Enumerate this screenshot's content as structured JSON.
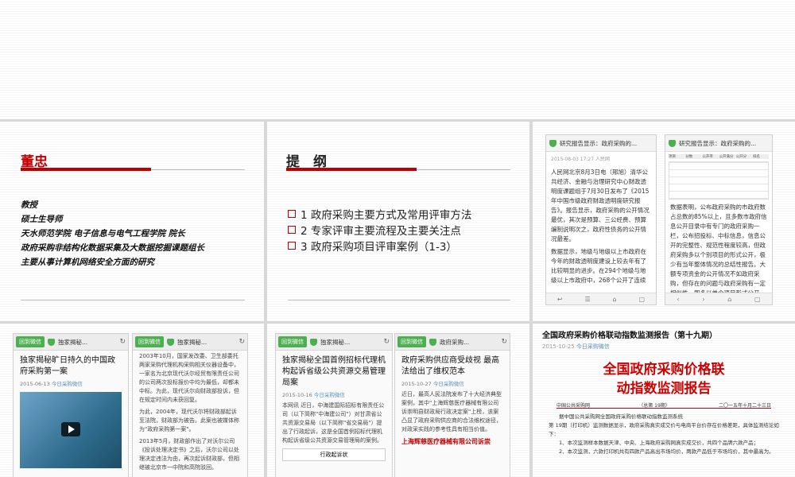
{
  "slide_intro": {
    "name": "董忠",
    "lines": [
      "教授",
      "硕士生导师",
      "天水师范学院 电子信息与电气工程学院 院长",
      "政府采购非结构化数据采集及大数据挖掘课题组长",
      "主要从事计算机网络安全方面的研究"
    ]
  },
  "slide_outline": {
    "title": "提　纲",
    "items": [
      "1 政府采购主要方式及常用评审方法",
      "2 专家评审主要流程及主要关注点",
      "3 政府采购项目评审案例（1-3）"
    ]
  },
  "phone1": {
    "header": "研究报告显示：政府采购的...",
    "date": "2015-08-03 17:27 人民网",
    "p1": "人民网北京8月3日电（邢旭）清华公共经济、金融与治理研究中心财政透明度课题组于7月30日发布了《2015年中国市级政府财政透明度研究报告》。报告显示，政府采购的公开情况最优，其次是预算、三公经费、预算编制说明次之，政府性债务的公开情况最差。",
    "p2": "数据显示，地级与地级以上市政府在今年的财政透明度建设上较去年有了比较明显的进步。在294个地级与地级以上市政府中，268个公开了连续"
  },
  "phone2": {
    "header": "研究报告显示：政府采购的...",
    "table_header": [
      "项目",
      "分数",
      "公开率",
      "公开满分",
      "公开分",
      "排名"
    ],
    "p1": "数据表明，公布政府采购的市政府数占总数的85%以上，且多数市政府信息公开目录中有专门的政府采购一栏，公布招投标、中标信息，信息公开的完整性、规范性程度较高，但政府采购多以个别项目的形式公开，极少有当年整体情况的总结性报告。大额专项资金的公开情况不如政府采购，但存在的问题与政府采购有一定相似性，即多以单个项目形式公开"
  },
  "wx1": {
    "back": "回到微信",
    "header": "独家揭秘...",
    "title": "独家揭秘旷日持久的中国政府采购第一案",
    "date": "2015-06-13",
    "source": "今日采购微信"
  },
  "wx2": {
    "back": "回到微信",
    "header": "独家揭秘...",
    "p1": "2003年10月，国家发改委、卫生部委托两家采购代理机构采购相关仪器设备中，一家名为北京现代沃尔经贸有限责任公司的公司两次投标报价中均为最低，却都未中标。为此，现代沃尔向财政部投诉，但在规定时间内未获回复。",
    "p2": "为此，2004年，现代沃尔将财政部起诉至法院，财政部为被告。此案也被媒体称为\"政府采购第一案\"。",
    "p3": "2013年5月，财政部作出了对沃尔公司《投诉处理决定书》之后，沃尔公司以处理决定违法为由，再次起诉财政部，但相继被北京市一中院和高院驳回。"
  },
  "wx3": {
    "back": "回到微信",
    "header": "独家揭秘...",
    "title": "独家揭秘全国首例招标代理机构起诉省级公共资源交易管理局案",
    "date": "2015-10-16",
    "source": "今日采购微信",
    "p1": "本网讯 近日，中海建国际招标有限责任公司（以下简称\"中海建公司\"）对甘肃省公共资源交易局（以下简称\"省交易局\"）提出了行政起诉，这是全国首例招标代理机构起诉省级公共资源交易管理局的案例。",
    "doc_title": "行政起诉状"
  },
  "wx4": {
    "back": "回到微信",
    "header": "政府采购...",
    "title": "政府采购供应商受歧视 最高法给出了维权范本",
    "date": "2015-10-27",
    "source": "今日采购微信",
    "p1": "近日，最高人民法院发布了十大经济典型案例，其中\"上海辉慈医疗器械有限公司诉崇明县财政局行政决定案\"上榜，该案凸显了政府采购供应商的合法维权途径，对政采实践的参考性具有相当价值。",
    "red": "上海辉慈医疗器械有限公司诉崇"
  },
  "report": {
    "headline": "全国政府采购价格联动指数监测报告（第十九期）",
    "date": "2015-10-25",
    "source": "今日采购微信",
    "title1": "全国政府采购价格联",
    "title2": "动指数监测报告",
    "meta_left": "中国公共采购网",
    "meta_mid": "（总第 19期）",
    "meta_right": "二〇一五年十月二十三日",
    "p1": "据中国公共采购网全国政府采购价格联动指数监测系统",
    "p2": "第 19期（打印机）监测数据显示，政府采购真实成交价与电商平台价存在价格差距，具体监测结论如下：",
    "p3": "1、本次监测样本数据天津、中央、上海政府采购网真实成交价，共四个品牌六款产品；",
    "p4": "2、本次监测，六款打印机共有四款产品高出市场均价，两款产品低于市场均价，其中最高为。"
  }
}
